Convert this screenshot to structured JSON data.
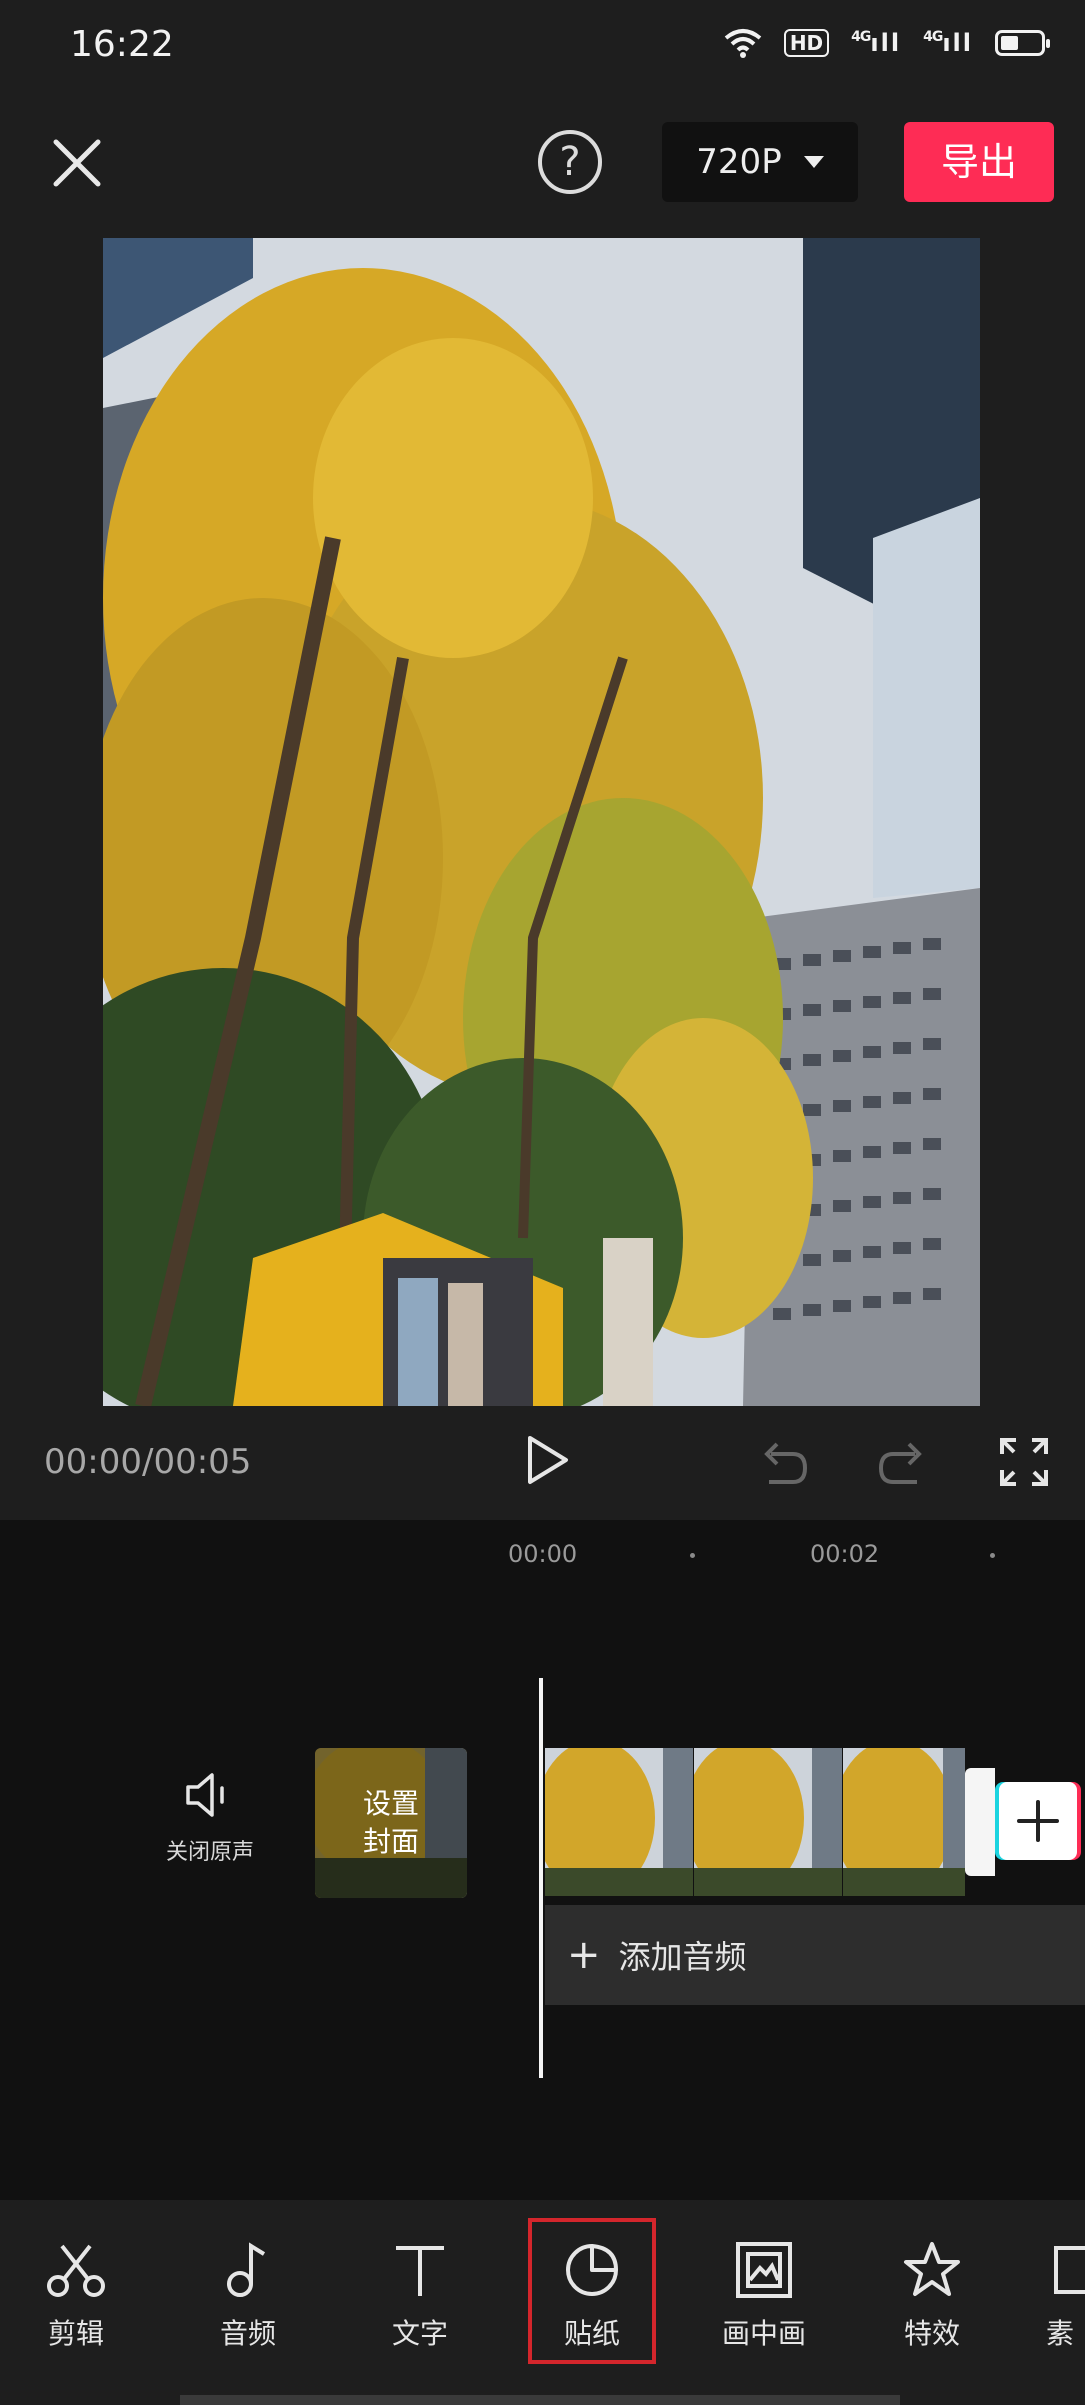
{
  "status_bar": {
    "time": "16:22",
    "network_1": "4G",
    "network_2": "4G",
    "hd_badge": "HD",
    "battery_level": 0.45
  },
  "top_bar": {
    "resolution": "720P",
    "export_label": "导出"
  },
  "playback": {
    "time_readout": "00:00/00:05"
  },
  "timeline": {
    "ruler_labels": [
      "00:00",
      "00:02"
    ],
    "mute_label": "关闭原声",
    "cover_label": "设置\n封面",
    "add_audio_label": "添加音频"
  },
  "toolbar": {
    "items": [
      {
        "label": "剪辑",
        "icon": "scissors-icon"
      },
      {
        "label": "音频",
        "icon": "music-note-icon"
      },
      {
        "label": "文字",
        "icon": "text-icon"
      },
      {
        "label": "贴纸",
        "icon": "sticker-icon"
      },
      {
        "label": "画中画",
        "icon": "picture-in-picture-icon"
      },
      {
        "label": "特效",
        "icon": "star-effect-icon"
      },
      {
        "label": "素",
        "icon": "material-icon"
      }
    ],
    "highlighted": "贴纸"
  },
  "colors": {
    "accent": "#fe2c55",
    "highlight_box": "#d4262c",
    "background": "#1e1e1e"
  }
}
